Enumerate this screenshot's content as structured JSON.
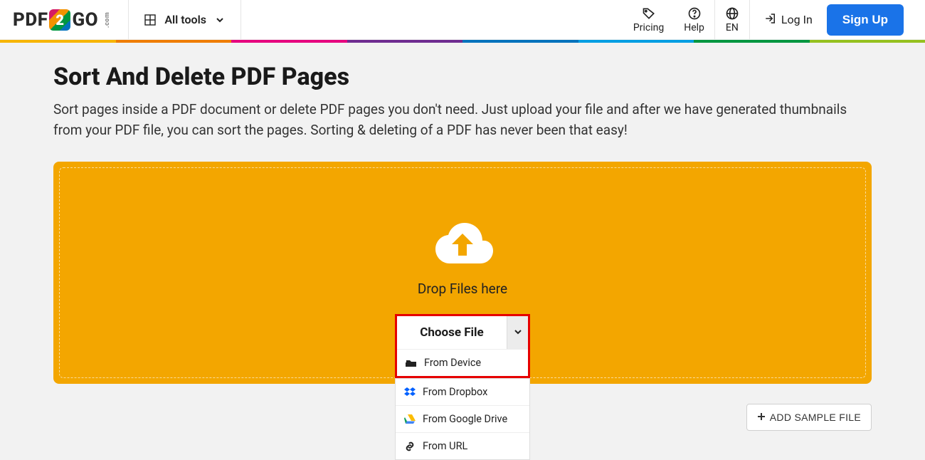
{
  "header": {
    "logo_pdf": "PDF",
    "logo_2": "2",
    "logo_go": "GO",
    "logo_com": ".com",
    "all_tools_label": "All tools",
    "nav": {
      "pricing": "Pricing",
      "help": "Help",
      "lang": "EN"
    },
    "login_label": "Log In",
    "signup_label": "Sign Up"
  },
  "stripe_colors": [
    "#f7b500",
    "#ef7d00",
    "#e6007e",
    "#6f2c91",
    "#0072bc",
    "#009ee3",
    "#009640",
    "#95c11f"
  ],
  "page": {
    "title": "Sort And Delete PDF Pages",
    "subtitle": "Sort pages inside a PDF document or delete PDF pages you don't need. Just upload your file and after we have generated thumbnails from your PDF file, you can sort the pages. Sorting & deleting of a PDF has never been that easy!"
  },
  "dropzone": {
    "drop_text": "Drop Files here",
    "choose_file_label": "Choose File",
    "options": {
      "device": "From Device",
      "dropbox": "From Dropbox",
      "gdrive": "From Google Drive",
      "url": "From URL"
    }
  },
  "sample_button": "ADD SAMPLE FILE"
}
